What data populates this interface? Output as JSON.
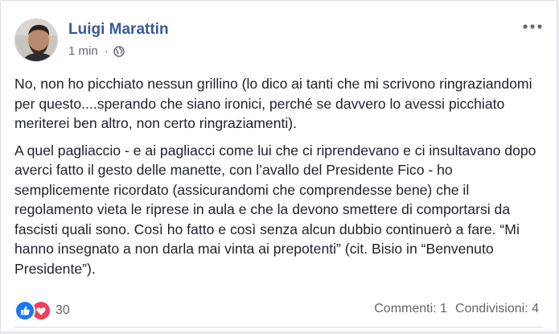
{
  "post": {
    "author": "Luigi Marattin",
    "time": "1 min",
    "separator": "·",
    "paragraphs": [
      "No, non ho picchiato nessun grillino (lo dico ai tanti che mi scrivono ringraziandomi per questo....sperando che siano ironici, perché se davvero lo avessi picchiato meriterei ben altro, non certo ringraziamenti).",
      "A quel pagliaccio - e ai pagliacci come lui che ci riprendevano e ci insultavano dopo averci fatto il gesto delle manette, con l’avallo del Presidente Fico - ho semplicemente ricordato (assicurandomi che comprendesse bene) che il regolamento vieta le riprese in aula e che la devono smettere di comportarsi da fascisti quali sono. Così ho fatto e così senza alcun dubbio continuerò a fare. “Mi hanno insegnato a non darla mai vinta ai prepotenti” (cit. Bisio in “Benvenuto Presidente”)."
    ],
    "privacy_icon": "globe-icon",
    "menu_icon": "more-options-icon"
  },
  "footer": {
    "reaction_icons": [
      "like-icon",
      "love-icon"
    ],
    "reaction_count": "30",
    "comments": "Commenti: 1",
    "shares": "Condivisioni: 4"
  },
  "colors": {
    "author": "#385898",
    "text": "#1d2129",
    "meta": "#616770",
    "like": "#1877f2",
    "love": "#f33e58"
  }
}
